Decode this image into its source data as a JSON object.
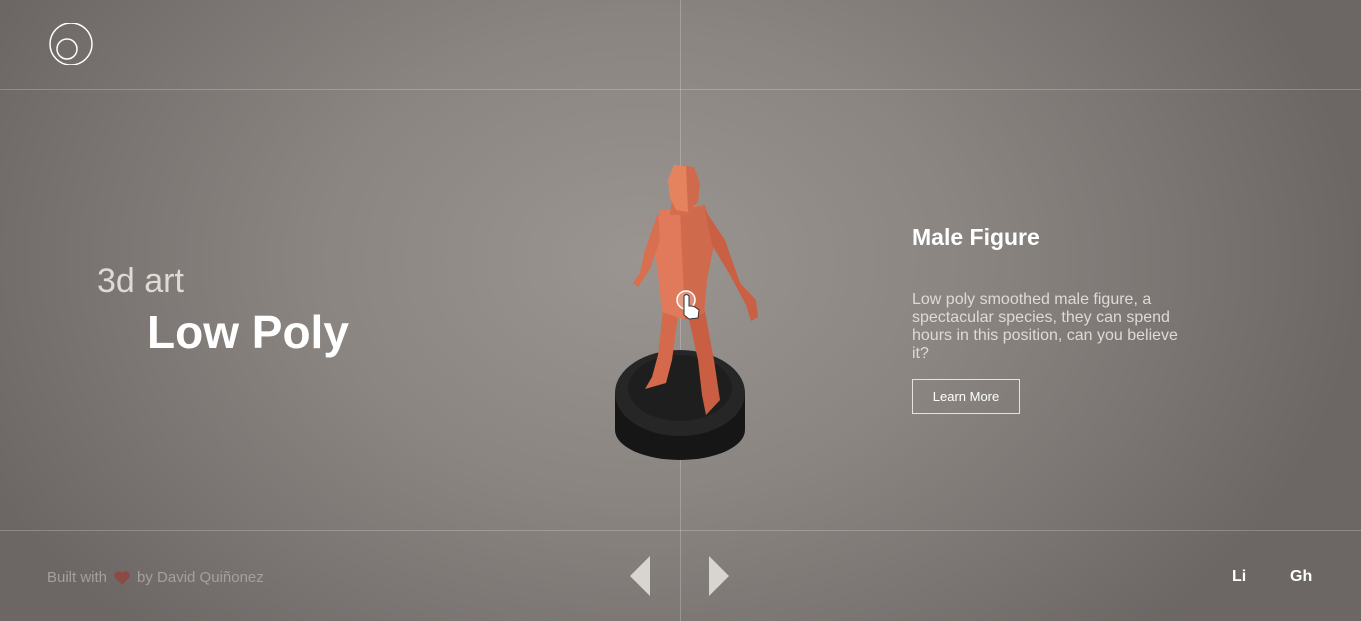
{
  "header": {
    "logo_icon": "circle-logo-icon"
  },
  "hero": {
    "subtitle": "3d art",
    "title": "Low Poly"
  },
  "model": {
    "name": "male-figure-3d-model",
    "accent": "#e0785a",
    "base_color": "#1c1c1c"
  },
  "info": {
    "title": "Male Figure",
    "description": "Low poly smoothed male figure, a spectacular species, they can spend hours in this position, can you believe it?",
    "button_label": "Learn More"
  },
  "footer": {
    "built_with": "Built with",
    "by": "by David Quiñonez",
    "heart_icon": "heart-icon",
    "prev_icon": "prev-arrow-icon",
    "next_icon": "next-arrow-icon",
    "links": [
      "Li",
      "Gh"
    ]
  }
}
